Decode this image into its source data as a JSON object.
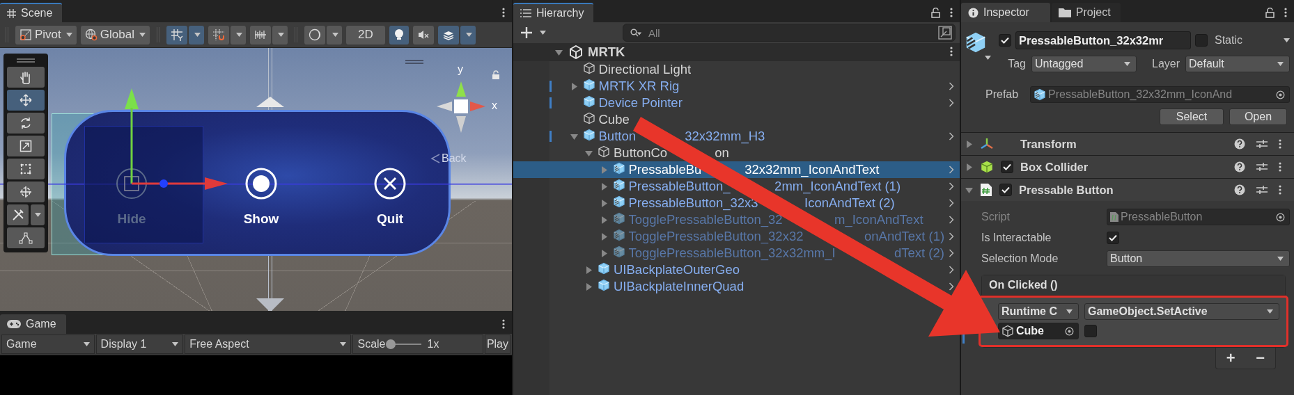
{
  "scene": {
    "tab": "Scene",
    "toolbar_groups": [
      [
        {
          "kind": "pivot",
          "label": "Pivot"
        },
        {
          "kind": "globe",
          "label": "Global"
        }
      ],
      [
        {
          "kind": "grid-snap",
          "selected": true
        },
        {
          "kind": "increment-snap",
          "selected": false
        },
        {
          "kind": "ruler",
          "selected": false
        }
      ],
      [
        {
          "kind": "shading",
          "selected": false
        },
        {
          "kind": "text",
          "label": "2D",
          "selected": false
        },
        {
          "kind": "light",
          "selected": true
        },
        {
          "kind": "audio",
          "selected": false
        },
        {
          "kind": "effects",
          "selected": true
        }
      ]
    ],
    "tools": [
      {
        "kind": "hand",
        "selected": false
      },
      {
        "kind": "move",
        "selected": true
      },
      {
        "kind": "rotate",
        "selected": false
      },
      {
        "kind": "scale",
        "selected": false
      },
      {
        "kind": "rect",
        "selected": false
      },
      {
        "kind": "transform",
        "selected": false
      },
      {
        "kind": "custom",
        "selected": false
      },
      {
        "kind": "path",
        "selected": false
      }
    ],
    "menu_buttons": [
      {
        "kind": "hide",
        "label": "Hide",
        "disabled": true
      },
      {
        "kind": "show",
        "label": "Show",
        "disabled": false
      },
      {
        "kind": "quit",
        "label": "Quit",
        "disabled": false
      }
    ],
    "back_label": "Back",
    "axis_y": "y",
    "axis_x": "x"
  },
  "game": {
    "tab": "Game",
    "toolbar": [
      {
        "kind": "dropdown",
        "label": "Game"
      },
      {
        "kind": "dropdown",
        "label": "Display 1"
      },
      {
        "kind": "dropdown",
        "label": "Free Aspect"
      },
      {
        "kind": "slider",
        "label": "Scale",
        "level": 0.0,
        "reading": "1x"
      },
      {
        "kind": "text",
        "label": "Play"
      }
    ]
  },
  "hierarchy": {
    "tab": "Hierarchy",
    "search": {
      "placeholder": "All"
    },
    "root": {
      "name": "MRTK",
      "expanded": true,
      "children": [
        {
          "name": "Directional Light",
          "kind": "object"
        },
        {
          "name": "MRTK XR Rig",
          "kind": "prefab",
          "expanded": false,
          "overridden": true
        },
        {
          "name": "Device Pointer",
          "kind": "prefab",
          "overridden": true
        },
        {
          "name": "Cube",
          "kind": "object"
        },
        {
          "name": "Button",
          "name_end": "32x32mm_H3",
          "kind": "prefab",
          "expanded": true,
          "overridden": true,
          "children": [
            {
              "name": "ButtonCo",
              "name_end": "on",
              "kind": "object",
              "expanded": true,
              "children": [
                {
                  "name": "PressableBu",
                  "name_end": "32x32mm_IconAndText",
                  "kind": "variant",
                  "expanded": false,
                  "selected": true
                },
                {
                  "name": "PressableButton_",
                  "name_end": "2mm_IconAndText (1)",
                  "kind": "variant",
                  "expanded": false,
                  "selected": false
                },
                {
                  "name": "PressableButton_32x3",
                  "name_end": "IconAndText (2)",
                  "kind": "variant",
                  "expanded": false,
                  "selected": false
                },
                {
                  "name": "TogglePressableButton_32",
                  "name_end": "m_IconAndText",
                  "kind": "variant",
                  "expanded": false,
                  "selected": false,
                  "inactive": true
                },
                {
                  "name": "TogglePressableButton_32x32",
                  "name_end": "onAndText (1)",
                  "kind": "variant",
                  "expanded": false,
                  "selected": false,
                  "inactive": true
                },
                {
                  "name": "TogglePressableButton_32x32mm_I",
                  "name_end": "dText (2)",
                  "kind": "variant",
                  "expanded": false,
                  "selected": false,
                  "inactive": true
                }
              ]
            },
            {
              "name": "UIBackplateOuterGeo",
              "kind": "prefab",
              "expanded": false
            },
            {
              "name": "UIBackplateInnerQuad",
              "kind": "prefab",
              "expanded": false
            }
          ]
        }
      ]
    }
  },
  "inspector": {
    "tabs": [
      {
        "label": "Inspector",
        "kind": "info",
        "selected": true
      },
      {
        "label": "Project",
        "kind": "folder",
        "selected": false
      }
    ],
    "object": {
      "active": true,
      "name": "PressableButton_32x32mr",
      "static": false,
      "static_label": "Static",
      "tag_label": "Tag",
      "tag": "Untagged",
      "layer_label": "Layer",
      "layer": "Default",
      "prefab_label": "Prefab",
      "prefab": "PressableButton_32x32mm_IconAnd",
      "buttons": [
        "Select",
        "Open"
      ]
    },
    "components": [
      {
        "kind": "transform",
        "name": "Transform",
        "expanded": false
      },
      {
        "kind": "collider",
        "name": "Box Collider",
        "expanded": false,
        "enabled": true
      },
      {
        "kind": "script",
        "name": "Pressable Button",
        "expanded": true,
        "enabled": true
      }
    ],
    "fields": [
      {
        "kind": "object",
        "label": "Script",
        "value": "PressableButton",
        "disabled": true
      },
      {
        "kind": "checkbox",
        "label": "Is Interactable",
        "checked": true
      },
      {
        "kind": "dropdown",
        "label": "Selection Mode",
        "value": "Button"
      }
    ],
    "event": {
      "title": "On Clicked ()",
      "overridden": true,
      "runtime": "Runtime C",
      "function": "GameObject.SetActive",
      "target": "Cube",
      "argument": false,
      "add": "+",
      "remove": "−"
    }
  }
}
